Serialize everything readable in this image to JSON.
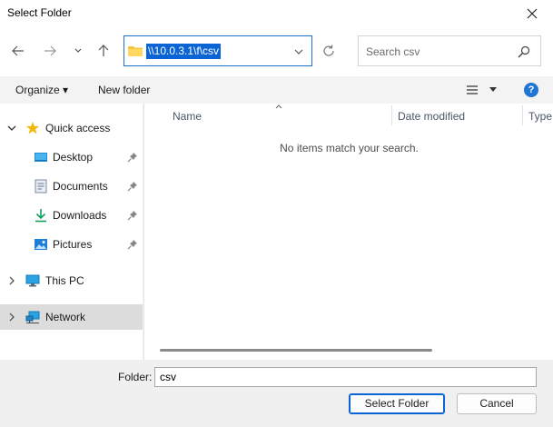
{
  "window": {
    "title": "Select Folder"
  },
  "nav": {
    "address": "\\\\10.0.3.1\\f\\csv",
    "search_placeholder": "Search csv"
  },
  "toolbar": {
    "organize_label": "Organize ▾",
    "new_folder_label": "New folder"
  },
  "sidebar": {
    "items": [
      {
        "label": "Quick access",
        "icon": "star-icon"
      },
      {
        "label": "Desktop",
        "icon": "desktop-icon",
        "pinned": true
      },
      {
        "label": "Documents",
        "icon": "documents-icon",
        "pinned": true
      },
      {
        "label": "Downloads",
        "icon": "download-icon",
        "pinned": true
      },
      {
        "label": "Pictures",
        "icon": "pictures-icon",
        "pinned": true
      },
      {
        "label": "This PC",
        "icon": "computer-icon"
      },
      {
        "label": "Network",
        "icon": "network-icon",
        "selected": true
      }
    ]
  },
  "content": {
    "columns": [
      "Name",
      "Date modified",
      "Type"
    ],
    "empty_message": "No items match your search."
  },
  "footer": {
    "folder_label": "Folder:",
    "folder_value": "csv",
    "select_label": "Select Folder",
    "cancel_label": "Cancel"
  },
  "colors": {
    "accent": "#0a64d6",
    "selection_bg": "#dcdcdc",
    "help_blue": "#1f74d4"
  }
}
